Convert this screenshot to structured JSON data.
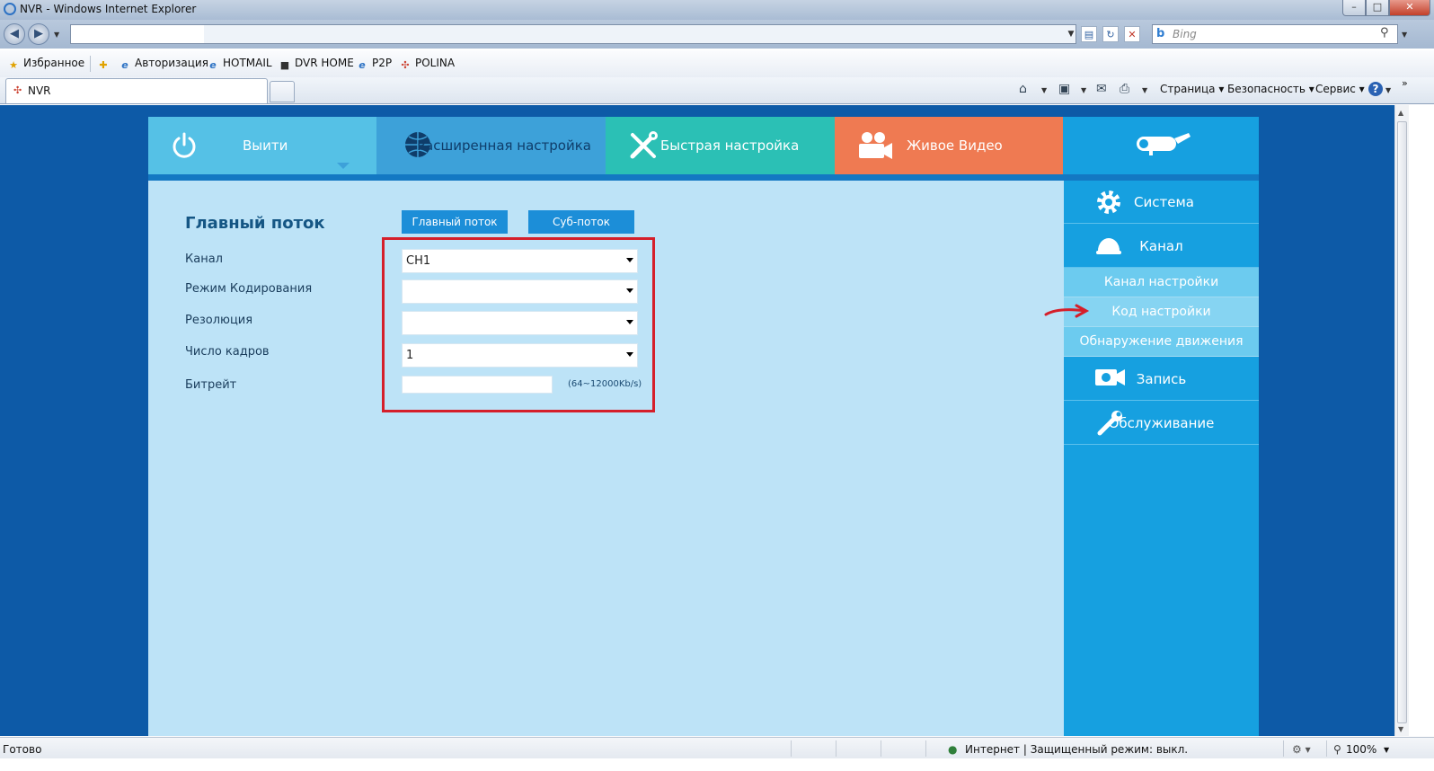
{
  "window": {
    "title": "NVR - Windows Internet Explorer",
    "min": "–",
    "max": "□",
    "close": "✕"
  },
  "toolbar": {
    "address": "",
    "search_placeholder": "Bing",
    "search_logo": "b"
  },
  "favorites": {
    "label": "Избранное",
    "links": [
      "Авторизация",
      "HOTMAIL",
      "DVR HOME",
      "P2P",
      "POLINA"
    ]
  },
  "tabs": {
    "active": "NVR"
  },
  "commands": {
    "page": "Страница ▾",
    "safety": "Безопасность ▾",
    "tools": "Сервис ▾",
    "help": "?"
  },
  "nav": {
    "logout": "Выити",
    "advanced": "Расширенная настройка",
    "quick": "Быстрая настройка",
    "live": "Живое Видео"
  },
  "sidebar": {
    "system": "Система",
    "channel": "Канал",
    "channel_settings": "Канал настройки",
    "code_settings": "Код настройки",
    "motion": "Обнаружение движения",
    "record": "Запись",
    "maintenance": "Обслуживание"
  },
  "form": {
    "title": "Главный поток",
    "tab_main": "Главный поток",
    "tab_sub": "Суб-поток",
    "fields": {
      "channel": {
        "label": "Канал",
        "value": "CH1"
      },
      "encoding": {
        "label": "Режим Кодирования",
        "value": ""
      },
      "resolution": {
        "label": "Резолюция",
        "value": ""
      },
      "framerate": {
        "label": "Число кадров",
        "value": "1"
      },
      "bitrate": {
        "label": "Битрейт",
        "value": "",
        "range": "(64~12000Kb/s)"
      }
    }
  },
  "status": {
    "left": "Готово",
    "zone": "Интернет | Защищенный режим: выкл.",
    "zoom": "100%"
  },
  "colors": {
    "page_bg": "#0d5aa7",
    "panel_bg": "#bde3f7",
    "sidebar_bg": "#16a0e0",
    "nav_logout": "#55c1e6",
    "nav_advanced": "#3da1d9",
    "nav_quick": "#2bc0b5",
    "nav_live": "#ef7a52",
    "highlight_box": "#d51f2a"
  }
}
